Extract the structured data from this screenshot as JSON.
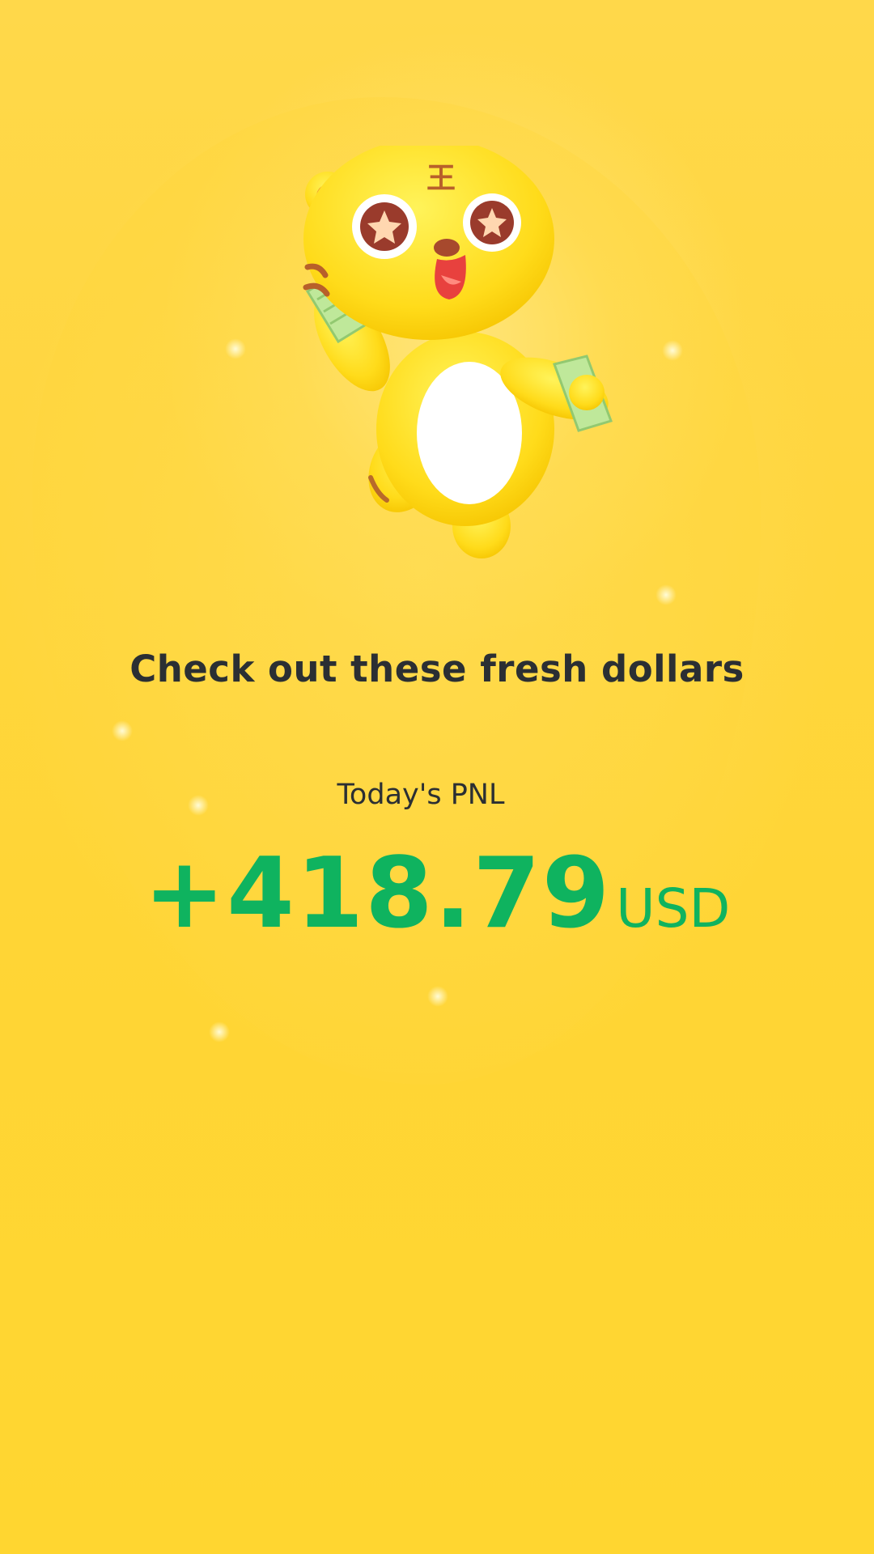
{
  "headline": "Check out these fresh dollars",
  "pnl": {
    "label": "Today's PNL",
    "amount": "+418.79",
    "currency": "USD",
    "color": "#0fb35f"
  },
  "mascot": {
    "icon": "tiger-mascot-icon",
    "forehead_text": "王"
  },
  "colors": {
    "background": "#ffd63f",
    "text": "#2b2f33"
  }
}
